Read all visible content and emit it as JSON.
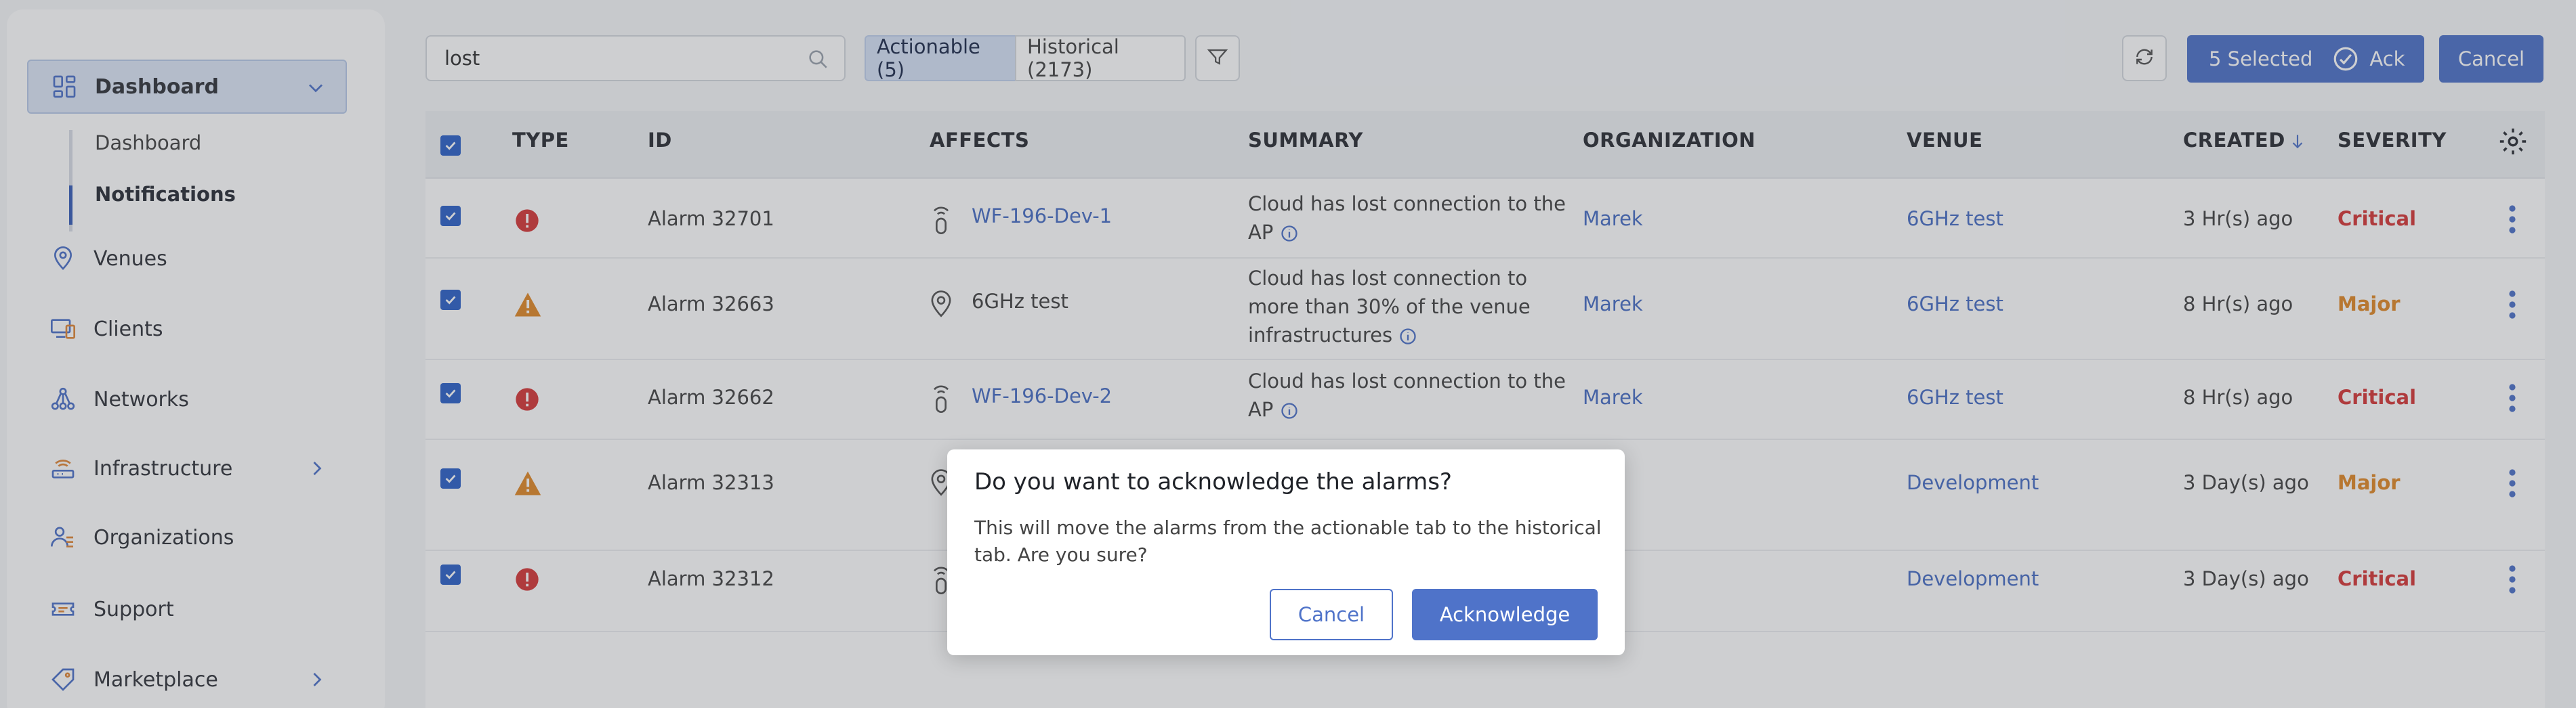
{
  "colors": {
    "accent": "#4f73c9",
    "critical": "#d63a3a",
    "major": "#e08a2a",
    "link": "#4a6fc4"
  },
  "sidebar": {
    "items": [
      {
        "label": "Dashboard",
        "icon": "dashboard-icon",
        "active": true,
        "expandable": true
      },
      {
        "label": "Venues",
        "icon": "location-pin-icon"
      },
      {
        "label": "Clients",
        "icon": "devices-icon"
      },
      {
        "label": "Networks",
        "icon": "network-icon"
      },
      {
        "label": "Infrastructure",
        "icon": "router-icon",
        "expandable": true
      },
      {
        "label": "Organizations",
        "icon": "people-icon"
      },
      {
        "label": "Support",
        "icon": "ticket-icon"
      },
      {
        "label": "Marketplace",
        "icon": "tag-icon",
        "expandable": true
      }
    ],
    "sub_items": [
      "Dashboard",
      "Notifications"
    ]
  },
  "toolbar": {
    "search_value": "lost",
    "tab_actionable": "Actionable (5)",
    "tab_historical": "Historical (2173)",
    "selected_label": "5 Selected",
    "ack_label": "Ack",
    "cancel_label": "Cancel"
  },
  "table": {
    "columns": [
      "TYPE",
      "ID",
      "AFFECTS",
      "SUMMARY",
      "ORGANIZATION",
      "VENUE",
      "CREATED",
      "SEVERITY"
    ],
    "rows": [
      {
        "type": "critical",
        "id": "Alarm 32701",
        "affects": "WF-196-Dev-1",
        "affects_kind": "ap",
        "summary": "Cloud has lost connection to the AP",
        "org": "Marek",
        "venue": "6GHz test",
        "created": "3 Hr(s) ago",
        "severity": "Critical"
      },
      {
        "type": "major",
        "id": "Alarm 32663",
        "affects": "6GHz test",
        "affects_kind": "venue",
        "summary": "Cloud has lost connection to more than 30% of the venue infrastructures",
        "org": "Marek",
        "venue": "6GHz test",
        "created": "8 Hr(s) ago",
        "severity": "Major"
      },
      {
        "type": "critical",
        "id": "Alarm 32662",
        "affects": "WF-196-Dev-2",
        "affects_kind": "ap",
        "summary": "Cloud has lost connection to the AP",
        "org": "Marek",
        "venue": "6GHz test",
        "created": "8 Hr(s) ago",
        "severity": "Critical"
      },
      {
        "type": "major",
        "id": "Alarm 32313",
        "affects": "",
        "affects_kind": "venue",
        "summary": "",
        "org": "ek",
        "venue": "Development",
        "created": "3 Day(s) ago",
        "severity": "Major"
      },
      {
        "type": "critical",
        "id": "Alarm 32312",
        "affects": "",
        "affects_kind": "ap",
        "summary": "",
        "org": "ek",
        "venue": "Development",
        "created": "3 Day(s) ago",
        "severity": "Critical"
      }
    ]
  },
  "dialog": {
    "title": "Do you want to acknowledge the alarms?",
    "body": "This will move the alarms from the actionable tab to the historical tab. Are you sure?",
    "cancel_label": "Cancel",
    "ack_label": "Acknowledge"
  }
}
